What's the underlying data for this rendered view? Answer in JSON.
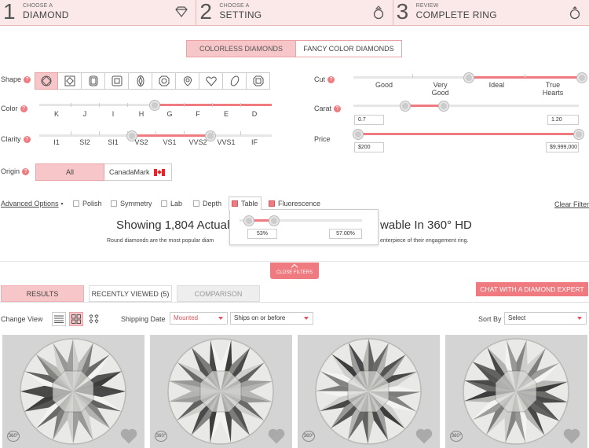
{
  "steps": [
    {
      "num": "1",
      "small": "CHOOSE A",
      "big": "DIAMOND",
      "icon": "diamond-icon"
    },
    {
      "num": "2",
      "small": "CHOOSE A",
      "big": "SETTING",
      "icon": "ring-icon"
    },
    {
      "num": "3",
      "small": "REVIEW",
      "big": "COMPLETE RING",
      "icon": "ring-icon"
    }
  ],
  "type_tabs": {
    "colorless": "COLORLESS DIAMONDS",
    "fancy": "FANCY COLOR DIAMONDS"
  },
  "filters": {
    "shape_label": "Shape",
    "color_label": "Color",
    "clarity_label": "Clarity",
    "origin_label": "Origin",
    "cut_label": "Cut",
    "carat_label": "Carat",
    "price_label": "Price",
    "color_ticks": [
      "K",
      "J",
      "I",
      "H",
      "G",
      "F",
      "E",
      "D"
    ],
    "clarity_ticks": [
      "I1",
      "SI2",
      "SI1",
      "VS2",
      "VS1",
      "VVS2",
      "VVS1",
      "IF"
    ],
    "cut_ticks": [
      "Good",
      "Very Good",
      "Ideal",
      "True Hearts"
    ],
    "carat_min": "0.7",
    "carat_max": "1.20",
    "price_min": "$200",
    "price_max": "$9,999,000",
    "origin_all": "All",
    "origin_cm": "CanadaMark",
    "help": "?"
  },
  "advanced": {
    "label": "Advanced Options",
    "items": [
      {
        "label": "Polish",
        "checked": false
      },
      {
        "label": "Symmetry",
        "checked": false
      },
      {
        "label": "Lab",
        "checked": false
      },
      {
        "label": "Depth",
        "checked": false
      },
      {
        "label": "Table",
        "checked": true
      },
      {
        "label": "Fluorescence",
        "checked": true
      }
    ],
    "clear": "Clear Filter",
    "table_min": "53%",
    "table_max": "57.00%"
  },
  "results": {
    "headline_left": "Showing 1,804 Actual F",
    "headline_right": "wable In 360° HD",
    "sub_left": "Round diamonds are the most popular diam",
    "sub_right": "enterpiece of their engagement ring.",
    "close_filters": "CLOSE FILTERS"
  },
  "result_tabs": {
    "results": "RESULTS",
    "recent": "RECENTLY VIEWED (5)",
    "comparison": "COMPARISON"
  },
  "chat": "CHAT WITH A DIAMOND EXPERT",
  "toolbar": {
    "change_view": "Change View",
    "shipping_label": "Shipping Date",
    "shipping_value": "Mounted",
    "ships_value": "Ships on or before",
    "sort_label": "Sort By",
    "sort_value": "Select"
  },
  "badge_360": "360°",
  "colors": {
    "accent": "#ef7a7f",
    "accent_light": "#f7c6c8"
  }
}
